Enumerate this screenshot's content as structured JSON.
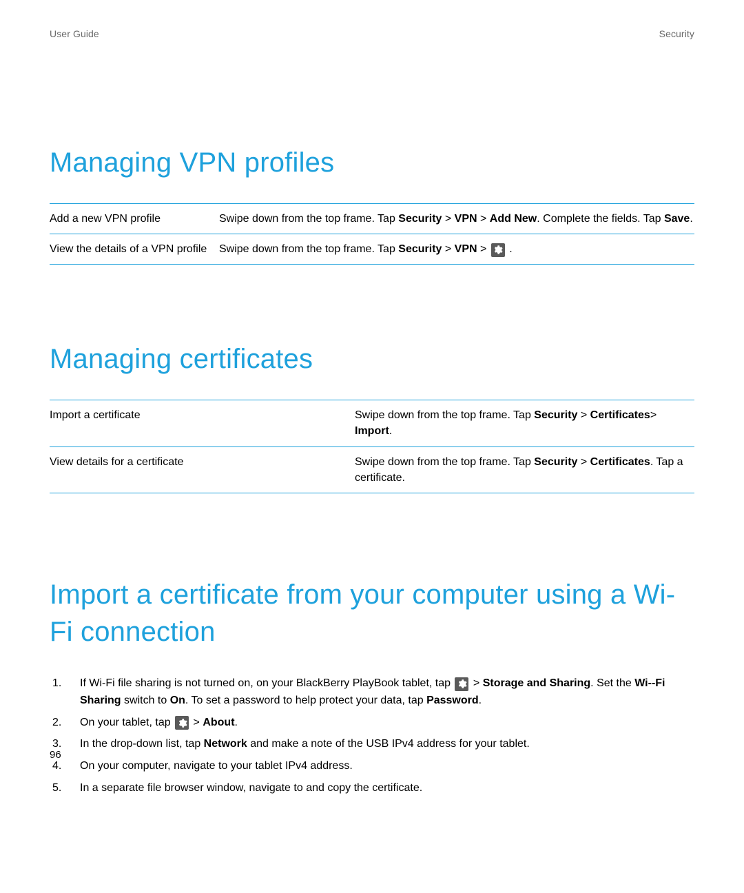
{
  "header": {
    "left": "User Guide",
    "right": "Security"
  },
  "section1": {
    "title": "Managing VPN profiles",
    "rows": [
      {
        "left": "Add a new VPN profile",
        "right_pre": "Swipe down from the top frame. Tap ",
        "bold1": "Security",
        "sep1": " > ",
        "bold2": "VPN",
        "sep2": " > ",
        "bold3": "Add New",
        "post1": ". Complete the fields. Tap ",
        "bold4": "Save",
        "post2": "."
      },
      {
        "left": "View the details of a VPN profile",
        "right_pre": "Swipe down from the top frame. Tap ",
        "bold1": "Security",
        "sep1": " > ",
        "bold2": "VPN",
        "sep2": " > ",
        "post_icon": "  ."
      }
    ]
  },
  "section2": {
    "title": "Managing certificates",
    "rows": [
      {
        "left": "Import a certificate",
        "right_pre": "Swipe down from the top frame. Tap ",
        "bold1": "Security",
        "sep1": " > ",
        "bold2": "Certificates",
        "sep2": "> ",
        "bold3": "Import",
        "post": "."
      },
      {
        "left": "View details for a certificate",
        "right_pre": "Swipe down from the top frame. Tap ",
        "bold1": "Security",
        "sep1": " > ",
        "bold2": "Certificates",
        "post": ". Tap a certificate."
      }
    ]
  },
  "section3": {
    "title": "Import a certificate from your computer using a Wi-Fi connection",
    "steps": [
      {
        "pre": "If Wi-Fi file sharing is not turned on, on your BlackBerry PlayBook tablet, tap ",
        "icon": "gear",
        "sep1": " > ",
        "bold1": "Storage and Sharing",
        "mid1": ". Set the ",
        "bold2": "Wi-‑Fi Sharing",
        "mid2": " switch to ",
        "bold3": "On",
        "mid3": ". To set a password to help protect your data, tap ",
        "bold4": "Password",
        "post": "."
      },
      {
        "pre": "On your tablet, tap ",
        "icon": "gear",
        "sep1": " > ",
        "bold1": "About",
        "post": "."
      },
      {
        "pre": "In the drop-down list, tap ",
        "bold1": "Network",
        "post": " and make a note of the USB IPv4 address for your tablet."
      },
      {
        "plain": "On your computer, navigate to your tablet IPv4 address."
      },
      {
        "plain": "In a separate file browser window, navigate to and copy the certificate."
      }
    ]
  },
  "page_number": "96"
}
